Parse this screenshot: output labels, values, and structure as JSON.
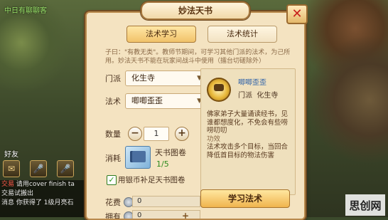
{
  "hud": {
    "player_name": "中日有聊聊客",
    "friend_label": "好友",
    "icons": [
      "chat-icon",
      "mic-icon",
      "mic-icon"
    ]
  },
  "chat": [
    {
      "tag": "交易",
      "text": "请用cover finish ta"
    },
    {
      "tag": "",
      "text": "交易试搬出"
    },
    {
      "tag": "",
      "text": "消息 你获得了 1级月亮石"
    }
  ],
  "dialog": {
    "title": "妙法天书",
    "close": "✕",
    "tabs": [
      {
        "label": "法术学习",
        "active": true
      },
      {
        "label": "法术统计",
        "active": false
      }
    ],
    "description": "子曰：\"有教无类\"。教师节期间，可学习其他门派的法术，为己所用。妙法天书不能在玩家间战斗中使用（擂台切磋除外）",
    "faction_label": "门派",
    "faction_value": "化生寺",
    "spell_label": "法术",
    "spell_value": "唧唧歪歪",
    "qty_label": "数量",
    "qty_value": "1",
    "consume_label": "消耗",
    "consume_item": "天书图卷",
    "consume_count": "1/5",
    "checkbox_label": "用银币补足天书图卷",
    "checkbox_checked": true,
    "cost_label": "花费",
    "cost_value": "0",
    "own_label": "拥有",
    "own_value": "0",
    "spell_info": {
      "name": "唧唧歪歪",
      "school_label": "门派",
      "school_value": "化生寺",
      "desc": "佛家弟子大量诵读经书，见谁都想度化，不免会有些唠唠叨叨",
      "effect_label": "功效",
      "effect": "法术攻击多个目标，当回合降低首目标的物法伤害"
    },
    "learn_button": "学习法术"
  },
  "watermark": "思创网",
  "colors": {
    "accent": "#f0b44e",
    "spell_name": "#2a5fa8",
    "close": "#c8201c"
  }
}
